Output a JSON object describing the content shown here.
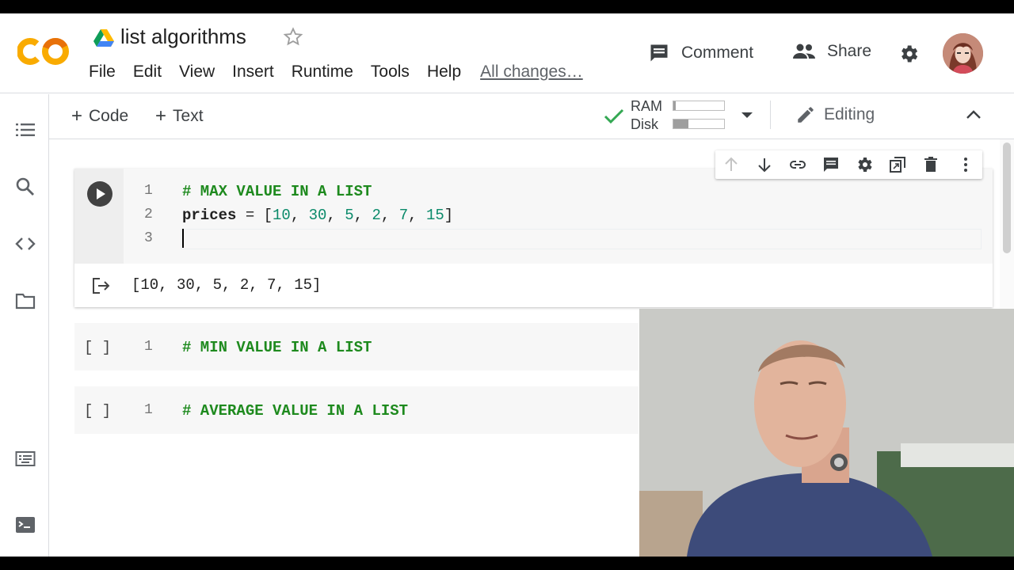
{
  "app": {
    "title": "list algorithms",
    "logo_text": "CO"
  },
  "menu": {
    "items": [
      "File",
      "Edit",
      "View",
      "Insert",
      "Runtime",
      "Tools",
      "Help"
    ],
    "status": "All changes…"
  },
  "header": {
    "comment_label": "Comment",
    "share_label": "Share"
  },
  "toolbar": {
    "add_code": "Code",
    "add_text": "Text",
    "ram_label": "RAM",
    "disk_label": "Disk",
    "ram_fill": 0.05,
    "disk_fill": 0.3,
    "mode_label": "Editing"
  },
  "cells": [
    {
      "lines": [
        {
          "number": "1",
          "comment": "# MAX VALUE IN A LIST"
        },
        {
          "number": "2",
          "ident": "prices",
          "op": " = [",
          "values": [
            "10",
            "30",
            "5",
            "2",
            "7",
            "15"
          ],
          "close": "]"
        },
        {
          "number": "3"
        }
      ],
      "output": "[10, 30, 5, 2, 7, 15]"
    },
    {
      "bracket": "[ ]",
      "lines": [
        {
          "number": "1",
          "comment": "# MIN VALUE IN A LIST"
        }
      ]
    },
    {
      "bracket": "[ ]",
      "lines": [
        {
          "number": "1",
          "comment": "# AVERAGE VALUE IN A LIST"
        }
      ]
    }
  ],
  "colors": {
    "comment": "#1e8a1e",
    "number": "#0a8a6a",
    "logo_orange": "#f9ab00",
    "logo_dark": "#e8710a"
  }
}
